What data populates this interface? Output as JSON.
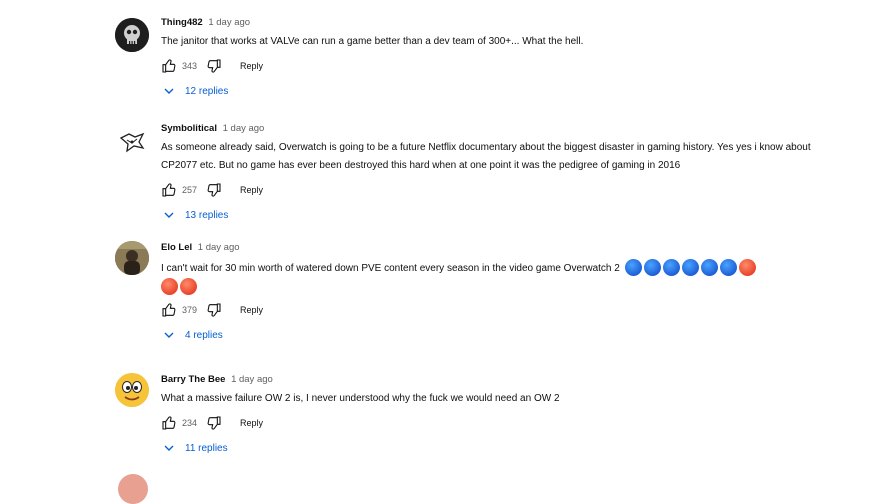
{
  "comments": [
    {
      "author": "Thing482",
      "time": "1 day ago",
      "text": "The janitor that works at VALVe can run a game better than a dev team of 300+... What the hell.",
      "likes": "343",
      "reply_label": "Reply",
      "replies_label": "12 replies"
    },
    {
      "author": "Symbolitical",
      "time": "1 day ago",
      "text": "As someone already said, Overwatch is going to be a future Netflix documentary about the biggest disaster in gaming history. Yes yes i know about CP2077 etc. But no game has ever been destroyed this hard when at one point it was the pedigree of gaming in 2016",
      "likes": "257",
      "reply_label": "Reply",
      "replies_label": "13 replies"
    },
    {
      "author": "Elo Lel",
      "time": "1 day ago",
      "text": "I can't wait for 30 min worth of watered down PVE content every season in the video game Overwatch 2",
      "emojis": [
        "blue-face",
        "blue-face",
        "blue-face",
        "blue-face",
        "blue-face",
        "blue-face",
        "red-face",
        "red-face",
        "red-face"
      ],
      "likes": "379",
      "reply_label": "Reply",
      "replies_label": "4 replies"
    },
    {
      "author": "Barry The Bee",
      "time": "1 day ago",
      "text": "What a massive failure OW 2 is, I never understood why the fuck we would need an OW 2",
      "likes": "234",
      "reply_label": "Reply",
      "replies_label": "11 replies"
    }
  ],
  "colors": {
    "link": "#065fd4",
    "meta": "#606060",
    "text": "#0f0f0f"
  }
}
